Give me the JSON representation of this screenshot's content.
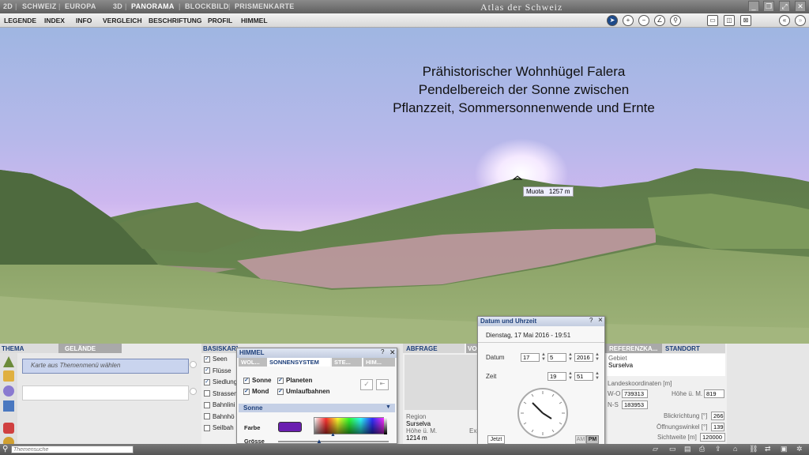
{
  "topbar": {
    "items": [
      "2D",
      "SCHWEIZ",
      "EUROPA",
      "3D",
      "PANORAMA",
      "BLOCKBILD",
      "PRISMENKARTE"
    ],
    "app_title": "Atlas der Schweiz"
  },
  "menu": [
    "LEGENDE",
    "INDEX",
    "INFO",
    "VERGLEICH",
    "BESCHRIFTUNG",
    "PROFIL",
    "HIMMEL"
  ],
  "scene": {
    "caption": [
      "Prähistorischer Wohnhügel Falera",
      "Pendelbereich der Sonne zwischen",
      "Pflanzzeit, Sommersonnenwende und Ernte"
    ],
    "peak_name": "Muota",
    "peak_height": "1257 m"
  },
  "thema": {
    "tab_active": "THEMA",
    "tab_inactive": "GELÄNDE",
    "select_placeholder": "Karte aus Themenmenü wählen"
  },
  "basiskarte": {
    "tab": "BASISKART",
    "items": [
      {
        "label": "Seen",
        "checked": true
      },
      {
        "label": "Flüsse",
        "checked": true
      },
      {
        "label": "Siedlung",
        "checked": true
      },
      {
        "label": "Strassen",
        "checked": false
      },
      {
        "label": "Bahnlini",
        "checked": false
      },
      {
        "label": "Bahnhö",
        "checked": false
      },
      {
        "label": "Seilbah",
        "checked": false
      }
    ]
  },
  "himmel": {
    "title": "HIMMEL",
    "tabs": [
      "WOL...",
      "SONNENSYSTEM",
      "STE...",
      "HIM..."
    ],
    "checks": [
      {
        "label": "Sonne",
        "checked": true
      },
      {
        "label": "Planeten",
        "checked": true
      },
      {
        "label": "Mond",
        "checked": true
      },
      {
        "label": "Umlaufbahnen",
        "checked": true
      }
    ],
    "section": "Sonne",
    "farbe_label": "Farbe",
    "groesse_label": "Grösse",
    "sun_color": "#6a1fb0"
  },
  "abfrage": {
    "tab": "ABFRAGE",
    "tab2": "VO",
    "region_label": "Region",
    "region_value": "Surselva",
    "height_label": "Höhe ü. M.",
    "height_value": "1214 m",
    "extra": "Exp"
  },
  "datetime": {
    "title": "Datum und Uhrzeit",
    "help": "?",
    "close": "×",
    "date_text": "Dienstag, 17 Mai 2016 - 19:51",
    "datum_label": "Datum",
    "day": "17",
    "month": "5",
    "year": "2016",
    "zeit_label": "Zeit",
    "hour": "19",
    "minute": "51",
    "jetzt": "Jetzt",
    "am": "AM",
    "pm": "PM"
  },
  "standort": {
    "tab_ref": "REFERENZKA...",
    "tab_active": "STANDORT",
    "gebiet_label": "Gebiet",
    "gebiet_value": "Surselva",
    "coords_label": "Landeskoordinaten [m]",
    "wo_label": "W-O",
    "wo_value": "739313",
    "ns_label": "N-S",
    "ns_value": "183953",
    "hoehe_label": "Höhe ü. M.",
    "hoehe_value": "819",
    "blick_label": "Blickrichtung [°]",
    "blick_value": "266",
    "oeffnung_label": "Öffnungswinkel [°]",
    "oeffnung_value": "139",
    "sicht_label": "Sichtweite [m]",
    "sicht_value": "120000"
  },
  "status": {
    "search_placeholder": "Themensuche"
  }
}
